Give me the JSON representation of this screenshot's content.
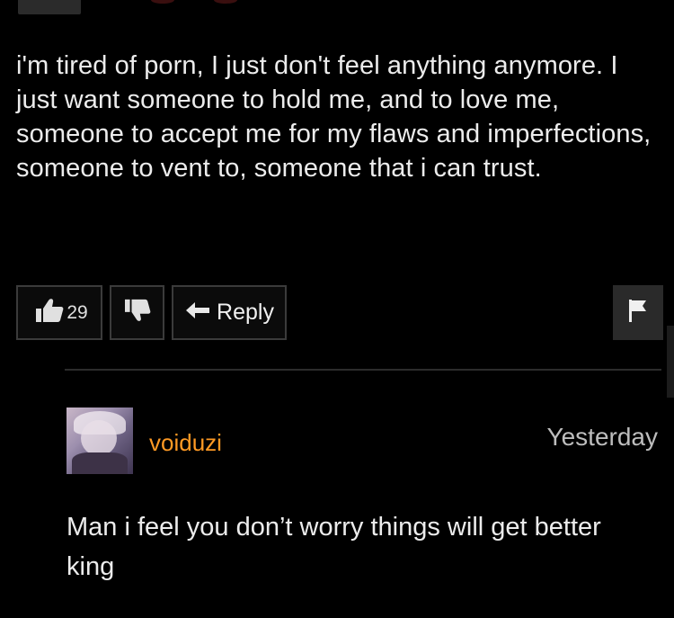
{
  "comment": {
    "text": "i'm tired of porn, I just don't feel anything anymore. I just want someone to hold me, and to love me, someone to accept me for my flaws and imperfections, someone to vent to, someone that i can trust.",
    "like_count": "29",
    "reply_label": "Reply",
    "icons": {
      "like": "thumbs-up-icon",
      "dislike": "thumbs-down-icon",
      "reply": "reply-arrow-icon",
      "flag": "flag-icon"
    }
  },
  "reply": {
    "username": "voiduzi",
    "timestamp": "Yesterday",
    "text": "Man i feel you don’t worry things will get better king",
    "username_color": "#ff9a24"
  },
  "colors": {
    "background": "#000000",
    "text": "#ececec",
    "button_border": "#3b3b3b",
    "flag_bg": "#2a2a2a"
  }
}
